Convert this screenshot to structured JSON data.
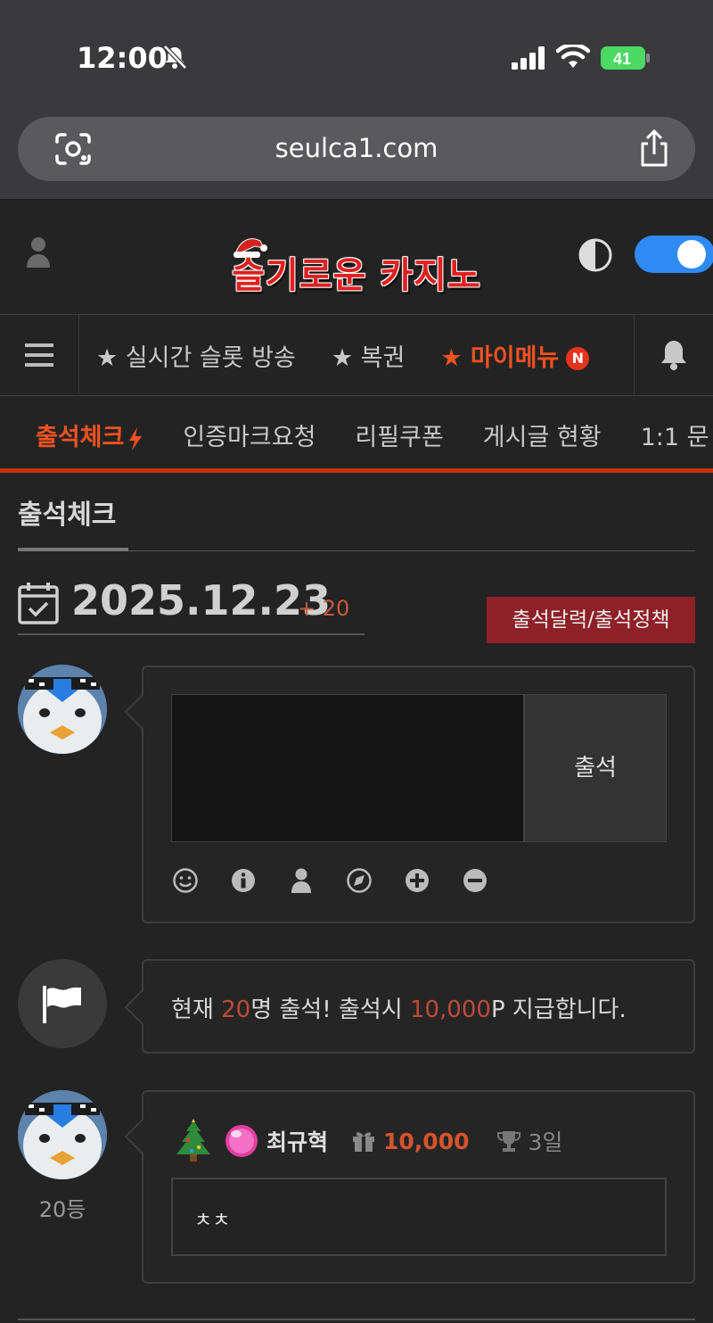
{
  "status_bar": {
    "time": "12:00",
    "battery": "41"
  },
  "browser": {
    "url": "seulca1.com"
  },
  "site": {
    "logo_text": "슬기로운 카지노"
  },
  "nav": {
    "items": [
      {
        "label": "★ 실시간 슬롯 방송"
      },
      {
        "label": "★ 복권"
      },
      {
        "label": "★ 마이메뉴",
        "badge": "N"
      }
    ]
  },
  "subtabs": [
    {
      "label": "출석체크"
    },
    {
      "label": "인증마크요청"
    },
    {
      "label": "리필쿠폰"
    },
    {
      "label": "게시글 현황"
    },
    {
      "label": "1:1 문"
    }
  ],
  "page": {
    "title": "출석체크",
    "date": "2025.12.23",
    "date_count": "+ 20",
    "policy_button": "출석달력/출석정책"
  },
  "attendance_form": {
    "submit_label": "출석",
    "tools": [
      "smile-icon",
      "info-icon",
      "user-icon",
      "compass-icon",
      "plus-circle-icon",
      "minus-circle-icon"
    ]
  },
  "notice": {
    "prefix": "현재 ",
    "count": "20",
    "middle": "명 출석! 출석시 ",
    "points": "10,000",
    "suffix": "P 지급합니다."
  },
  "entry": {
    "rank": "20등",
    "name": "최규혁",
    "points": "10,000",
    "days": "3일",
    "comment": "ㅊㅊ"
  },
  "colors": {
    "accent": "#f25220",
    "policy_button": "#8e2027",
    "toggle": "#2f8af5"
  }
}
